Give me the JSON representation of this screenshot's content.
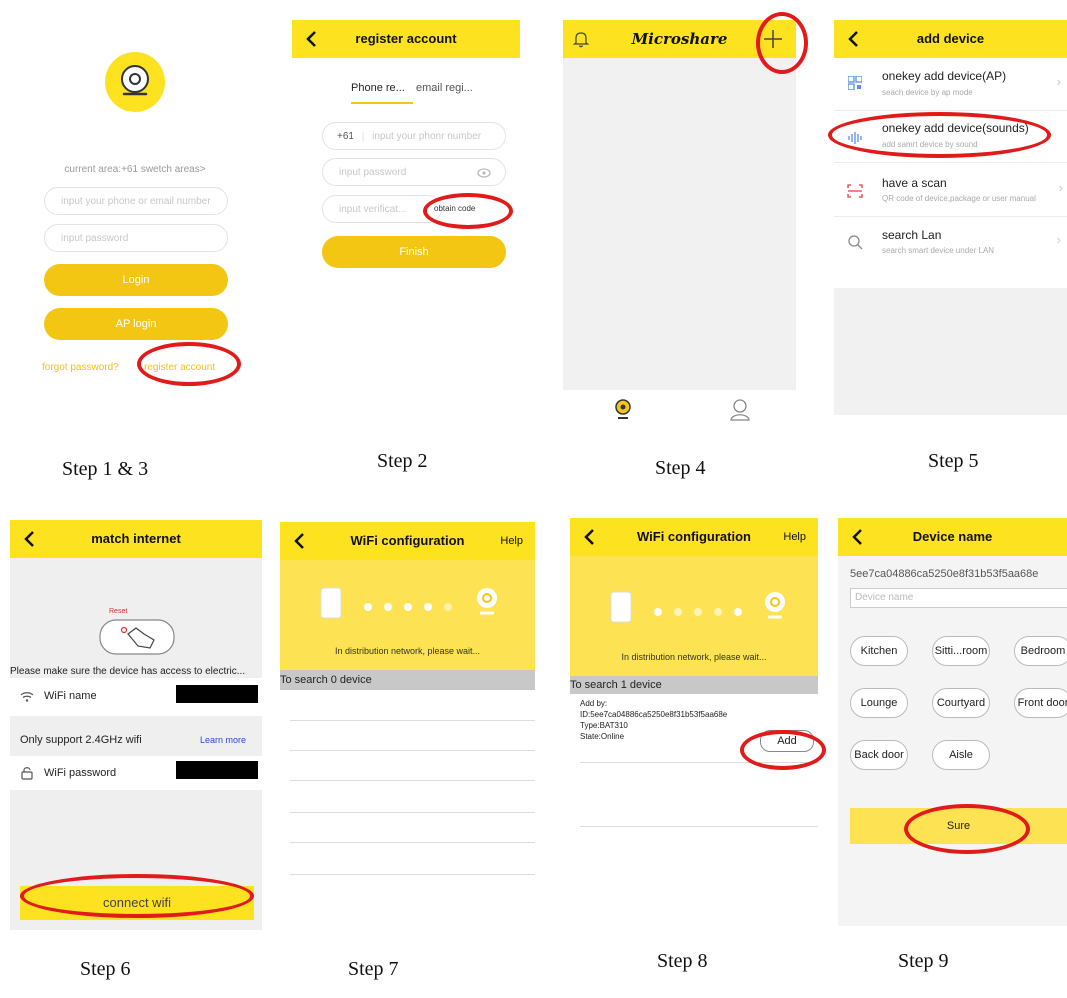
{
  "step1": {
    "area_text": "current area:+61 swetch areas>",
    "phone_placeholder": "input your phone or email number",
    "password_placeholder": "input password",
    "login_label": "Login",
    "ap_login_label": "AP login",
    "forgot_label": "forgot password?",
    "register_label": "register account"
  },
  "step2": {
    "title": "register account",
    "tab_phone": "Phone re...",
    "tab_email": "email regi...",
    "country_code": "+61",
    "phone_placeholder": "input your phonr number",
    "password_placeholder": "input password",
    "verify_placeholder": "input verificat...",
    "obtain_label": "obtain code",
    "finish_label": "Finish"
  },
  "step4": {
    "title": "Microshare"
  },
  "step5": {
    "title": "add device",
    "items": [
      {
        "title": "onekey add device(AP)",
        "sub": "seach device by ap mode"
      },
      {
        "title": "onekey add device(sounds)",
        "sub": "add samrt device by sound"
      },
      {
        "title": "have a scan",
        "sub": "QR code of device,package or user manual"
      },
      {
        "title": "search Lan",
        "sub": "search smart device under LAN"
      }
    ]
  },
  "step6": {
    "title": "match internet",
    "reset_label": "Reset",
    "notice": "Please make sure the device has access to electric...",
    "wifi_name_label": "WiFi name",
    "support_text": "Only support 2.4GHz wifi",
    "learn_more": "Learn more",
    "wifi_password_label": "WiFi password",
    "connect_label": "connect wifi"
  },
  "step7": {
    "title": "WiFi configuration",
    "help": "Help",
    "status": "In distribution network, please wait...",
    "search": "To search 0 device"
  },
  "step8": {
    "title": "WiFi configuration",
    "help": "Help",
    "status": "In distribution network, please wait...",
    "search": "To search 1 device",
    "add_by": "Add by:",
    "id": "ID:5ee7ca04886ca5250e8f31b53f5aa68e",
    "type": "Type:BAT310",
    "state": "State:Online",
    "add_label": "Add"
  },
  "step9": {
    "title": "Device name",
    "device_id": "5ee7ca04886ca5250e8f31b53f5aa68e",
    "name_placeholder": "Device name",
    "rooms": [
      "Kitchen",
      "Sitti...room",
      "Bedroom",
      "Lounge",
      "Courtyard",
      "Front door",
      "Back door",
      "Aisle"
    ],
    "sure_label": "Sure"
  },
  "captions": [
    "Step 1 & 3",
    "Step 2",
    "Step 4",
    "Step 5",
    "Step 6",
    "Step 7",
    "Step 8",
    "Step 9"
  ],
  "colors": {
    "brand_yellow": "#fde21f",
    "button_yellow": "#f4c614",
    "highlight_red": "#e11a1a"
  }
}
